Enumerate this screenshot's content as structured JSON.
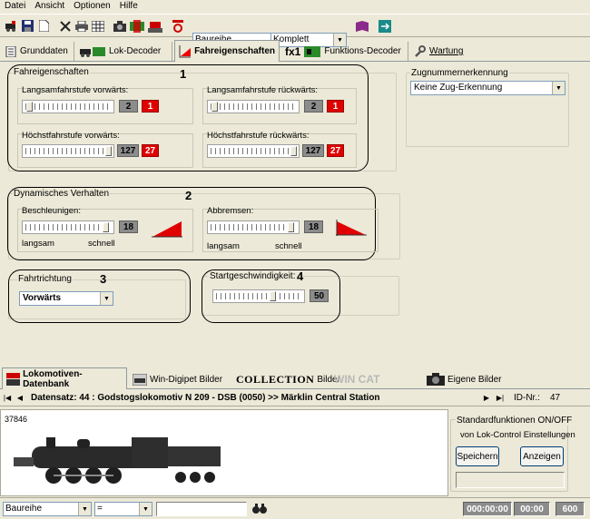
{
  "menu": [
    "Datei",
    "Ansicht",
    "Optionen",
    "Hilfe"
  ],
  "toolbar": {
    "combo1": "Baureihe",
    "combo2": "Komplett"
  },
  "tabs": [
    {
      "label": "Grunddaten"
    },
    {
      "label": "Lok-Decoder"
    },
    {
      "label": "Fahreigenschaften"
    },
    {
      "label": "Funktions-Decoder",
      "prefix": "fx1"
    },
    {
      "label": "Wartung"
    }
  ],
  "fahreigenschaften": {
    "title": "Fahreigenschaften",
    "marker": "1",
    "langsam_vor": {
      "label": "Langsamfahrstufe vorwärts:",
      "value": "2",
      "red": "1"
    },
    "langsam_rueck": {
      "label": "Langsamfahrstufe rückwärts:",
      "value": "2",
      "red": "1"
    },
    "hoechst_vor": {
      "label": "Höchstfahrstufe vorwärts:",
      "value": "127",
      "red": "27"
    },
    "hoechst_rueck": {
      "label": "Höchstfahrstufe rückwärts:",
      "value": "127",
      "red": "27"
    }
  },
  "dynamisch": {
    "title": "Dynamisches Verhalten",
    "marker": "2",
    "beschleunigen": {
      "label": "Beschleunigen:",
      "value": "18",
      "min": "langsam",
      "max": "schnell"
    },
    "abbremsen": {
      "label": "Abbremsen:",
      "value": "18",
      "min": "langsam",
      "max": "schnell"
    }
  },
  "fahrtrichtung": {
    "title": "Fahrtrichtung",
    "marker": "3",
    "value": "Vorwärts"
  },
  "startgeschw": {
    "title": "Startgeschwindigkeit:",
    "marker": "4",
    "value": "50"
  },
  "zugnummer": {
    "title": "Zugnummernerkennung",
    "value": "Keine Zug-Erkennung"
  },
  "lowtabs": [
    {
      "label": "Lokomotiven-Datenbank"
    },
    {
      "label": "Win-Digipet Bilder"
    },
    {
      "label": "Bilder",
      "logo": "COLLECTION"
    },
    {
      "label": "WIN CAT"
    },
    {
      "label": "Eigene Bilder"
    }
  ],
  "record": {
    "text": "Datensatz: 44 : Godstogslokomotiv N 209 - DSB  (0050) >> Märklin Central Station",
    "id_label": "ID-Nr.:",
    "id_value": "47",
    "article": "37846"
  },
  "standard": {
    "line1": "Standardfunktionen ON/OFF",
    "line2": "von Lok-Control Einstellungen",
    "save": "Speichern",
    "show": "Anzeigen"
  },
  "statusbar": {
    "combo1": "Baureihe",
    "combo2": "=",
    "t1": "000:00:00",
    "t2": "00:00",
    "t3": "600"
  }
}
